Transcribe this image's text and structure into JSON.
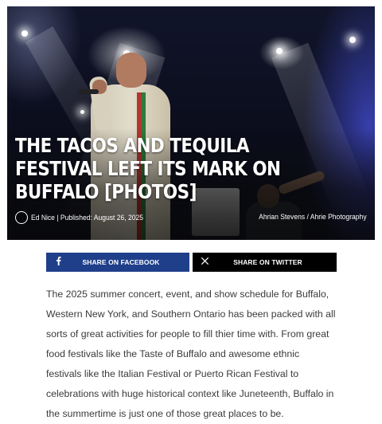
{
  "hero": {
    "title": "THE TACOS AND TEQUILA FESTIVAL LEFT ITS MARK ON BUFFALO [PHOTOS]",
    "byline": "Ed Nice | Published: August 26, 2025",
    "photo_credit": "Ahrian Stevens / Ahrie Photography"
  },
  "share": {
    "facebook_label": "SHARE ON FACEBOOK",
    "facebook_icon": "facebook-icon",
    "twitter_label": "SHARE ON TWITTER",
    "twitter_icon": "x-icon"
  },
  "article": {
    "paragraph_1": "The 2025 summer concert, event, and show schedule for Buffalo, Western New York, and Southern Ontario has been packed with all sorts of great activities for people to fill thier time with. From great food festivals like the Taste of Buffalo and awesome ethnic festivals like the Italian Festival or Puerto Rican Festival to celebrations with huge historical context like Juneteenth, Buffalo in the summertime is just one of those great places to be."
  },
  "colors": {
    "facebook": "#1f3f8a",
    "twitter": "#000000",
    "body_text": "#3a3a3a"
  }
}
